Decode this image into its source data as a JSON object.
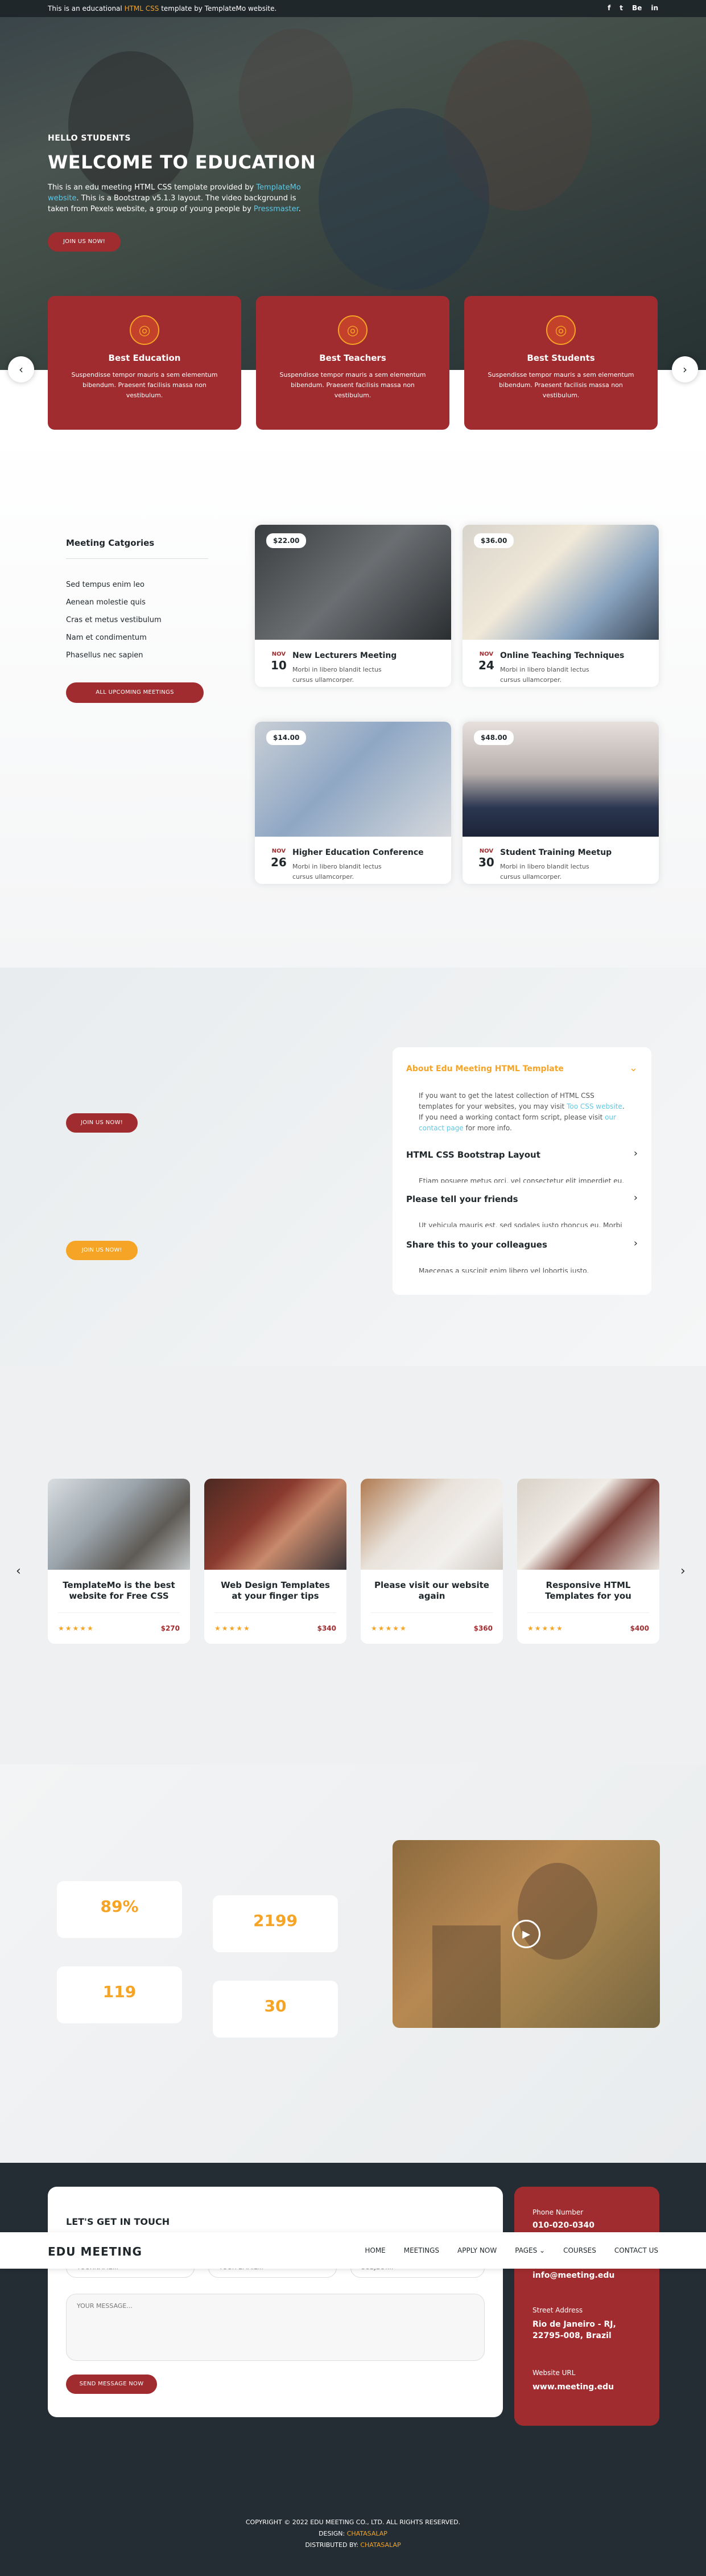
{
  "topbar": {
    "pre": "This is an educational ",
    "link": "HTML CSS",
    "post": " template by TemplateMo website.",
    "social": [
      "f",
      "t",
      "Be",
      "in"
    ]
  },
  "hero": {
    "subtitle": "HELLO STUDENTS",
    "title": "WELCOME TO EDUCATION",
    "p1": "This is an edu meeting HTML CSS template provided by ",
    "p1_link": "TemplateMo website",
    "p2": ". This is a Bootstrap v5.1.3 layout. The video background is taken from Pexels website, a group of young people by ",
    "p2_link": "Pressmaster",
    "p3": ".",
    "button": "JOIN US NOW!"
  },
  "features": [
    {
      "title": "Best Education",
      "text": "Suspendisse tempor mauris a sem elementum bibendum. Praesent facilisis massa non vestibulum."
    },
    {
      "title": "Best Teachers",
      "text": "Suspendisse tempor mauris a sem elementum bibendum. Praesent facilisis massa non vestibulum."
    },
    {
      "title": "Best Students",
      "text": "Suspendisse tempor mauris a sem elementum bibendum. Praesent facilisis massa non vestibulum."
    }
  ],
  "categories": {
    "title": "Meeting Catgories",
    "items": [
      "Sed tempus enim leo",
      "Aenean molestie quis",
      "Cras et metus vestibulum",
      "Nam et condimentum",
      "Phasellus nec sapien"
    ],
    "button": "ALL UPCOMING MEETINGS"
  },
  "meetings": [
    {
      "price": "$22.00",
      "month": "NOV",
      "day": "10",
      "title": "New Lecturers Meeting",
      "text": "Morbi in libero blandit lectus cursus ullamcorper."
    },
    {
      "price": "$36.00",
      "month": "NOV",
      "day": "24",
      "title": "Online Teaching Techniques",
      "text": "Morbi in libero blandit lectus cursus ullamcorper."
    },
    {
      "price": "$14.00",
      "month": "NOV",
      "day": "26",
      "title": "Higher Education Conference",
      "text": "Morbi in libero blandit lectus cursus ullamcorper."
    },
    {
      "price": "$48.00",
      "month": "NOV",
      "day": "30",
      "title": "Student Training Meetup",
      "text": "Morbi in libero blandit lectus cursus ullamcorper."
    }
  ],
  "apply": {
    "button1": "JOIN US NOW!",
    "button2": "JOIN US NOW!"
  },
  "accordion": [
    {
      "title": "About Edu Meeting HTML Template",
      "open": true,
      "body1": "If you want to get the latest collection of HTML CSS templates for your websites, you may visit ",
      "link1": "Too CSS website",
      "body2": ". If you need a working contact form script, please visit ",
      "link2": "our contact page",
      "body3": " for more info."
    },
    {
      "title": "HTML CSS Bootstrap Layout",
      "body": "Etiam posuere metus orci, vel consectetur elit imperdiet eu."
    },
    {
      "title": "Please tell your friends",
      "body": "Ut vehicula mauris est, sed sodales justo rhoncus eu. Morbi"
    },
    {
      "title": "Share this to your colleagues",
      "body": "Maecenas a suscipit enim libero vel lobortis justo."
    }
  ],
  "courses": [
    {
      "title": "TemplateMo is the best website for Free CSS",
      "price": "$270",
      "stars": "★★★★★"
    },
    {
      "title": "Web Design Templates at your finger tips",
      "price": "$340",
      "stars": "★★★★★"
    },
    {
      "title": "Please visit our website again",
      "price": "$360",
      "stars": "★★★★★"
    },
    {
      "title": "Responsive HTML Templates for you",
      "price": "$400",
      "stars": "★★★★★"
    }
  ],
  "facts": {
    "a": "89%",
    "b": "2199",
    "c": "119",
    "d": "30"
  },
  "nav": {
    "logo": "EDU MEETING",
    "links": [
      "HOME",
      "MEETINGS",
      "APPLY NOW",
      "PAGES",
      "COURSES",
      "CONTACT US"
    ]
  },
  "contact": {
    "title": "LET'S GET IN TOUCH",
    "name_ph": "YOURNAME...",
    "email_ph": "YOUR EMAIL...",
    "subject_ph": "SUBJECT...",
    "message_ph": "YOUR MESSAGE...",
    "button": "SEND MESSAGE NOW"
  },
  "info": {
    "phone_label": "Phone Number",
    "phone": "010-020-0340",
    "email": "info@meeting.edu",
    "street_label": "Street Address",
    "street": "Rio de Janeiro - RJ, 22795-008, Brazil",
    "web_label": "Website URL",
    "web": "www.meeting.edu"
  },
  "footer": {
    "copy": "COPYRIGHT © 2022 EDU MEETING CO., LTD. ALL RIGHTS RESERVED.",
    "design_pre": "DESIGN: ",
    "design": "CHATASALAP",
    "dist_pre": "DISTRIBUTED BY: ",
    "dist": "CHATASALAP"
  },
  "colors": {
    "primary": "#a12c2f",
    "accent": "#f5a425",
    "dark": "#1f272b"
  }
}
